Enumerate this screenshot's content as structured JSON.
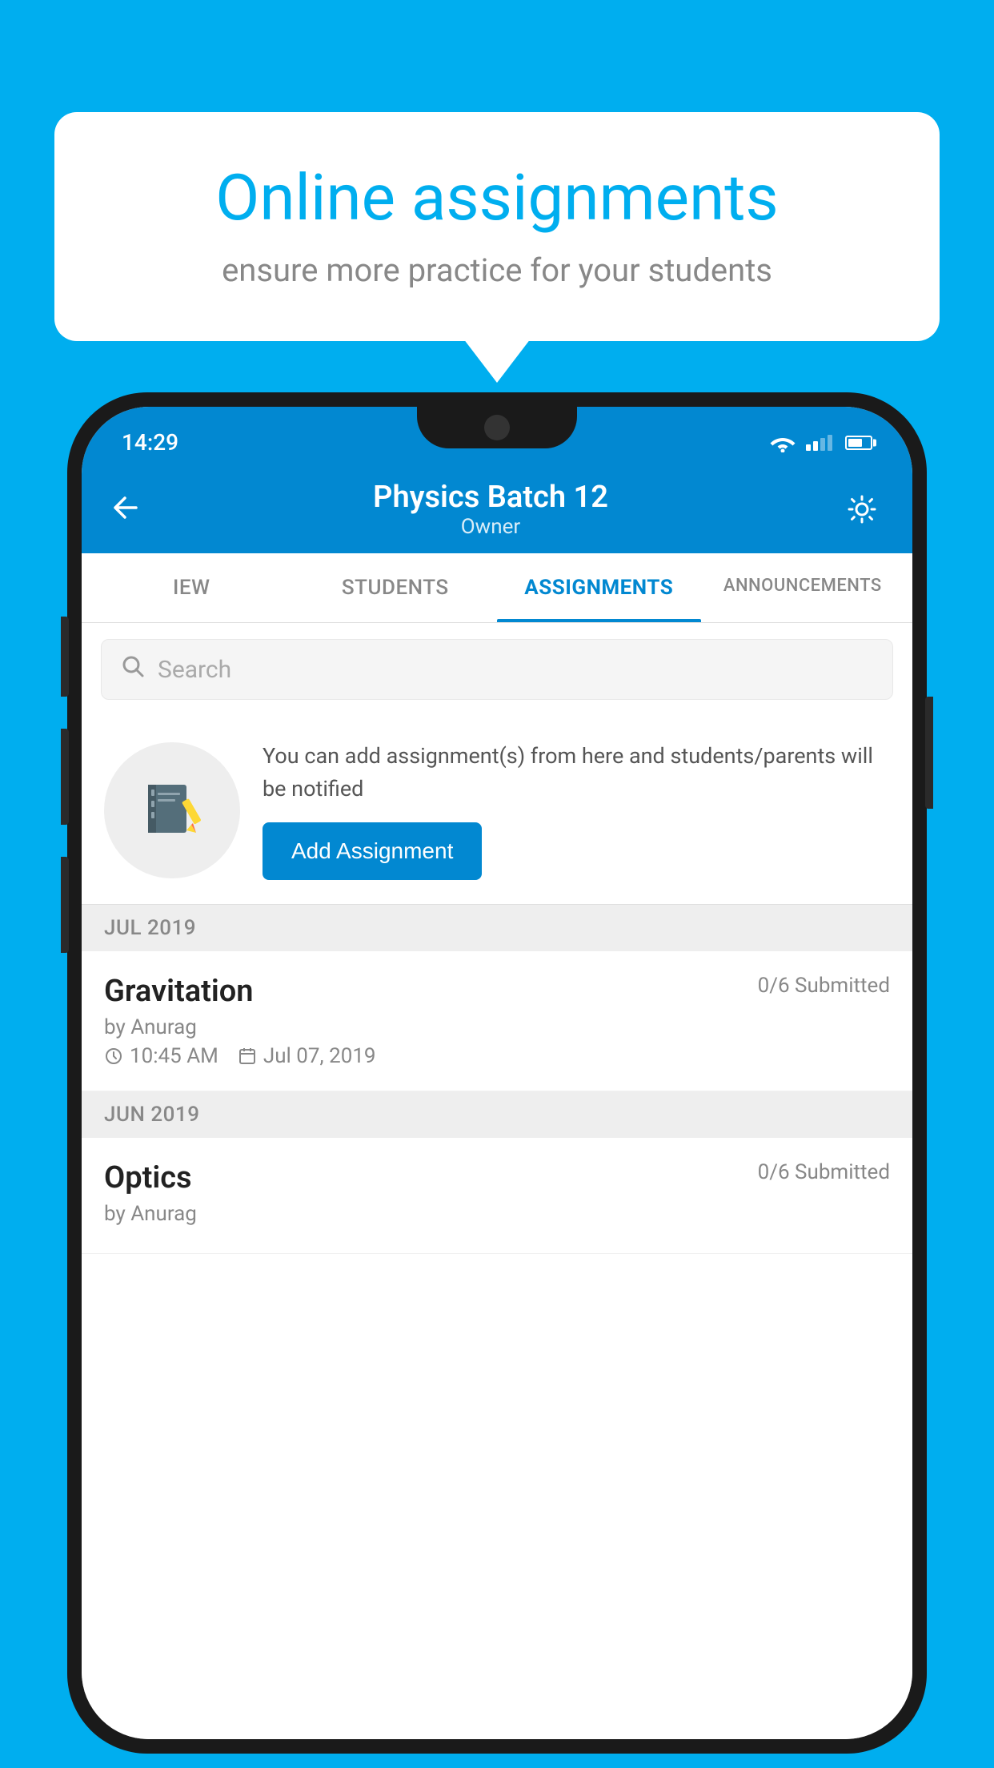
{
  "background_color": "#00AEEF",
  "speech_bubble": {
    "title": "Online assignments",
    "subtitle": "ensure more practice for your students"
  },
  "status_bar": {
    "time": "14:29"
  },
  "app_header": {
    "title": "Physics Batch 12",
    "subtitle": "Owner",
    "back_label": "back",
    "settings_label": "settings"
  },
  "tabs": [
    {
      "label": "IEW",
      "active": false
    },
    {
      "label": "STUDENTS",
      "active": false
    },
    {
      "label": "ASSIGNMENTS",
      "active": true
    },
    {
      "label": "ANNOUNCEMENTS",
      "active": false
    }
  ],
  "search": {
    "placeholder": "Search"
  },
  "promo": {
    "description": "You can add assignment(s) from here and students/parents will be notified",
    "button_label": "Add Assignment"
  },
  "assignment_groups": [
    {
      "month": "JUL 2019",
      "assignments": [
        {
          "title": "Gravitation",
          "submitted": "0/6 Submitted",
          "by": "by Anurag",
          "time": "10:45 AM",
          "date": "Jul 07, 2019"
        }
      ]
    },
    {
      "month": "JUN 2019",
      "assignments": [
        {
          "title": "Optics",
          "submitted": "0/6 Submitted",
          "by": "by Anurag",
          "time": "",
          "date": ""
        }
      ]
    }
  ]
}
